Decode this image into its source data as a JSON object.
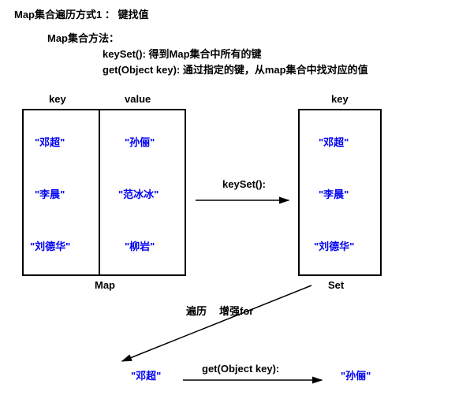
{
  "title": "Map集合遍历方式1 ： 键找值",
  "methods_title": "Map集合方法：",
  "method1": "keySet(): 得到Map集合中所有的键",
  "method2": "get(Object key): 通过指定的键，从map集合中找对应的值",
  "headers": {
    "key": "key",
    "value": "value",
    "setkey": "key"
  },
  "map": {
    "keys": [
      "\"邓超\"",
      "\"李晨\"",
      "\"刘德华\""
    ],
    "values": [
      "\"孙俪\"",
      "\"范冰冰\"",
      "\"柳岩\""
    ],
    "label": "Map"
  },
  "set": {
    "items": [
      "\"邓超\"",
      "\"李晨\"",
      "\"刘德华\""
    ],
    "label": "Set"
  },
  "arrows": {
    "keyset": "keySet():"
  },
  "traverse": {
    "l1": "遍历",
    "l2": "增强for"
  },
  "bottom": {
    "key": "\"邓超\"",
    "getlabel": "get(Object key):",
    "value": "\"孙俪\""
  }
}
